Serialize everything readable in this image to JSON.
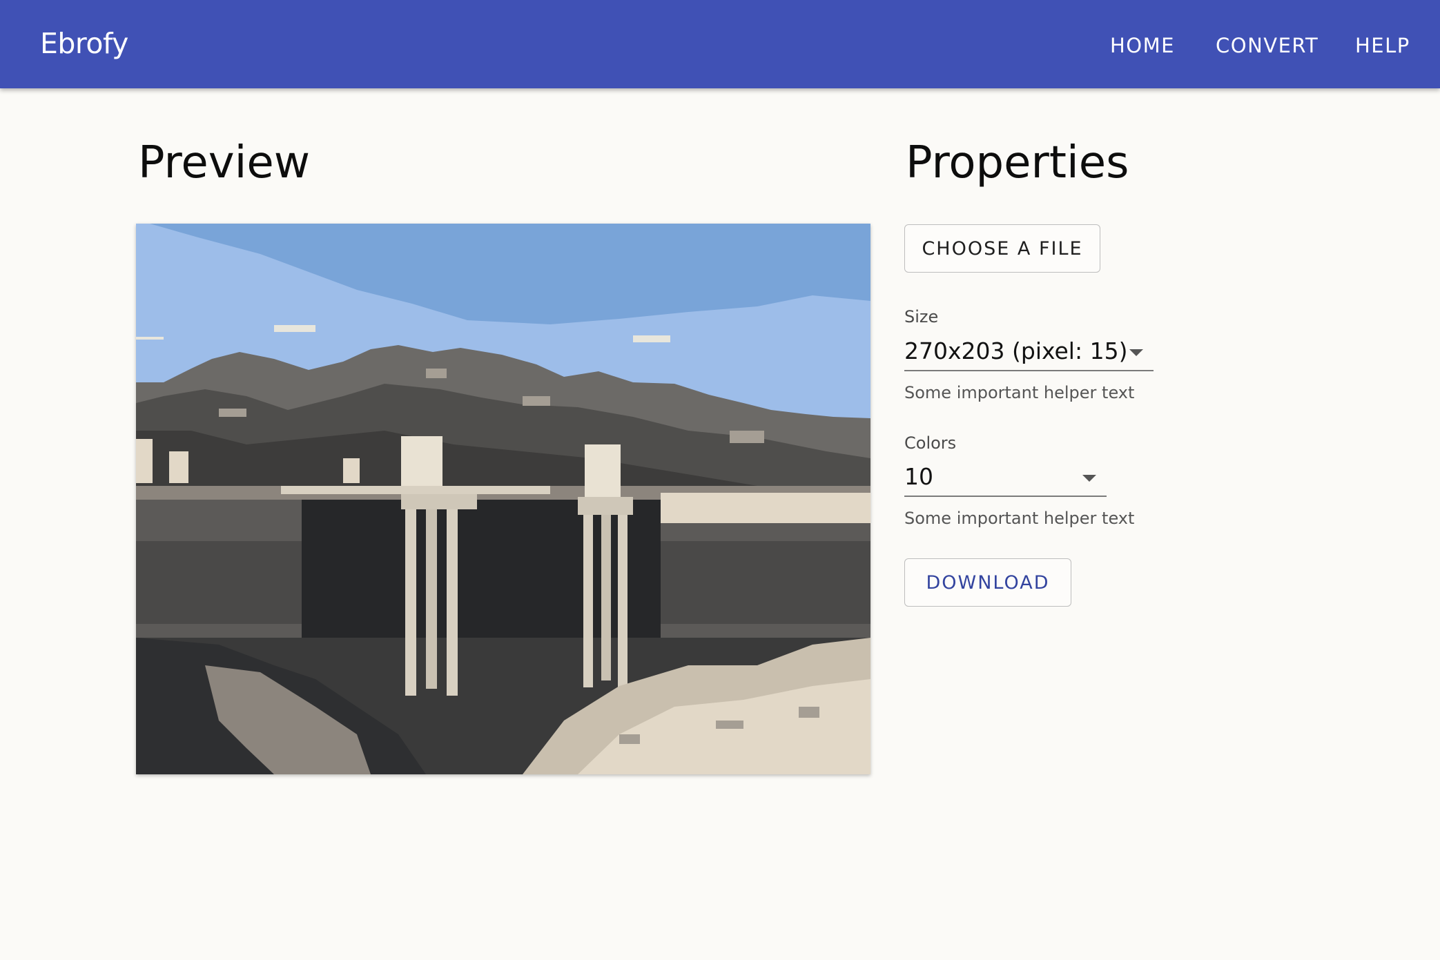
{
  "app": {
    "title": "Ebrofy",
    "nav": {
      "home": "HOME",
      "convert": "CONVERT",
      "help": "HELP"
    }
  },
  "preview": {
    "title": "Preview"
  },
  "properties": {
    "title": "Properties",
    "choose_file_label": "CHOOSE A FILE",
    "size": {
      "label": "Size",
      "value": "270x203 (pixel: 15)",
      "helper": "Some important helper text"
    },
    "colors": {
      "label": "Colors",
      "value": "10",
      "helper": "Some important helper text"
    },
    "download_label": "DOWNLOAD"
  },
  "theme": {
    "appbar": "#4051b5",
    "background": "#fbfaf7",
    "accent": "#33449f"
  }
}
